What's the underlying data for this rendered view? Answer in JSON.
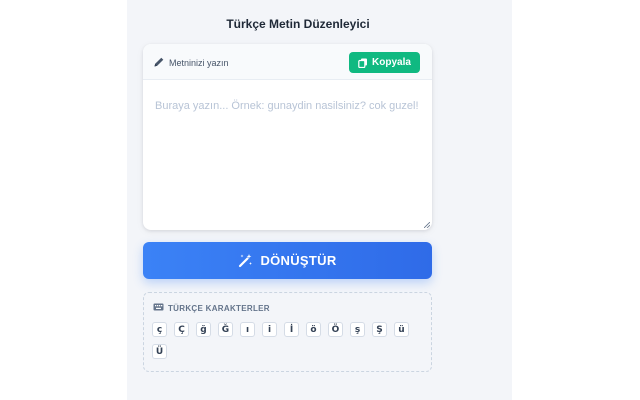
{
  "app": {
    "title": "Türkçe Metin Düzenleyici"
  },
  "editor": {
    "header_label": "Metninizi yazın",
    "copy_label": "Kopyala",
    "placeholder": "Buraya yazın... Örnek: gunaydin nasilsiniz? cok guzel!",
    "value": ""
  },
  "convert": {
    "label": "DÖNÜŞTÜR"
  },
  "turkish_chars": {
    "label": "TÜRKÇE KARAKTERLER",
    "keys": [
      "ç",
      "Ç",
      "ğ",
      "Ğ",
      "ı",
      "i",
      "İ",
      "ö",
      "Ö",
      "ş",
      "Ş",
      "ü",
      "Ü"
    ]
  },
  "colors": {
    "accent": "#3b82f6",
    "copy_button": "#10b981",
    "panel_background": "#f3f5f9"
  },
  "icons": {
    "header": "pencil-icon",
    "copy": "copy-icon",
    "convert": "magic-wand-icon",
    "chars": "keyboard-icon"
  }
}
